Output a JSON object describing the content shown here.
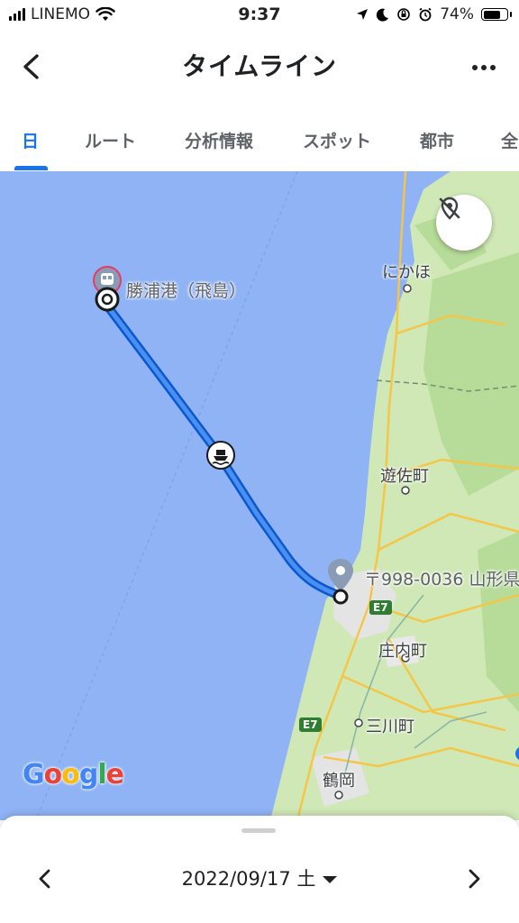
{
  "status_bar": {
    "carrier": "LINEMO",
    "time": "9:37",
    "battery_percent": "74%",
    "battery_level": 0.74,
    "icons": [
      "cellular-signal-icon",
      "wifi-icon",
      "location-arrow-icon",
      "moon-icon",
      "rotation-lock-icon",
      "alarm-icon",
      "battery-icon"
    ]
  },
  "header": {
    "title": "タイムライン",
    "back_icon": "chevron-left-icon",
    "more_icon": "more-horizontal-icon"
  },
  "tabs": [
    {
      "label": "日",
      "active": true
    },
    {
      "label": "ルート",
      "active": false
    },
    {
      "label": "分析情報",
      "active": false
    },
    {
      "label": "スポット",
      "active": false
    },
    {
      "label": "都市",
      "active": false
    },
    {
      "label": "全",
      "active": false
    }
  ],
  "map": {
    "labels": {
      "port": "勝浦港（飛島）",
      "nikaho": "にかほ",
      "yuza": "遊佐町",
      "address": "〒998-0036 山形県",
      "shonai": "庄内町",
      "mikawa": "三川町",
      "tsuruoka": "鶴岡",
      "expressway_1": "E7",
      "expressway_2": "E7"
    },
    "logo": "Google",
    "colors": {
      "sea": "#8fb3f5",
      "land": "#cfe8b6",
      "route": "#1a73e8",
      "accent": "#1a73e8"
    },
    "icons": [
      "train-station-icon",
      "ferry-icon",
      "location-pin-icon",
      "location-off-icon"
    ]
  },
  "bottom_sheet": {
    "date": "2022/09/17 土",
    "prev_icon": "chevron-left-icon",
    "next_icon": "chevron-right-icon"
  }
}
